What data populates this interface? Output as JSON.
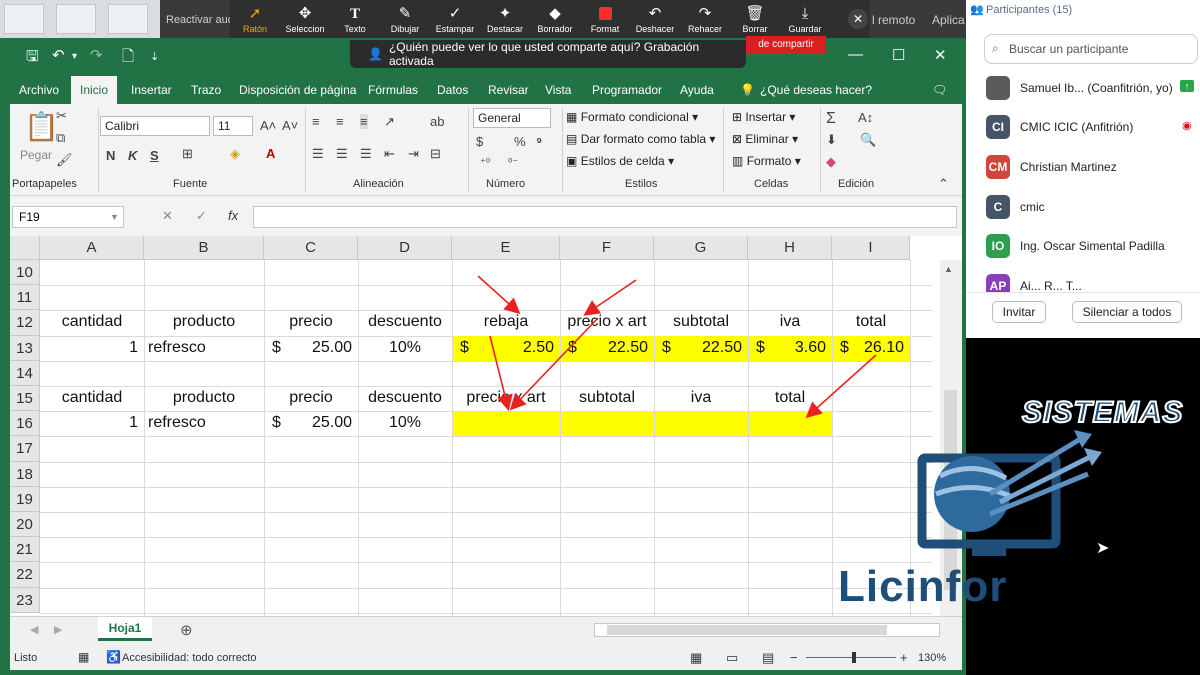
{
  "desktop": {
    "reactivar_label": "Reactivar aud"
  },
  "zoom_toolbar": {
    "tools": [
      "Ratón",
      "Seleccion",
      "Texto",
      "Dibujar",
      "Estampar",
      "Destacar",
      "Borrador",
      "Format",
      "Deshacer",
      "Rehacer",
      "Borrar",
      "Guardar"
    ],
    "active_tool": "Ratón"
  },
  "right_labels": {
    "remoto": "l remoto",
    "aplica": "Aplica"
  },
  "share_banner": {
    "text": "¿Quién puede ver lo que usted comparte aquí? Grabación activada",
    "red_label": "de compartir"
  },
  "excel": {
    "menu_tabs": [
      "Archivo",
      "Inicio",
      "Insertar",
      "Trazo",
      "Disposición de página",
      "Fórmulas",
      "Datos",
      "Revisar",
      "Vista",
      "Programador",
      "Ayuda"
    ],
    "active_tab": "Inicio",
    "tell_me": "¿Qué deseas hacer?",
    "ribbon": {
      "pegar": "Pegar",
      "font_name": "Calibri",
      "font_size": "11",
      "number_format": "General",
      "estilos_items": [
        "Formato condicional",
        "Dar formato como tabla",
        "Estilos de celda"
      ],
      "celdas_items": [
        "Insertar",
        "Eliminar",
        "Formato"
      ],
      "groups": [
        "Portapapeles",
        "Fuente",
        "Alineación",
        "Número",
        "Estilos",
        "Celdas",
        "Edición"
      ]
    },
    "name_box": "F19",
    "columns": [
      "A",
      "B",
      "C",
      "D",
      "E",
      "F",
      "G",
      "H",
      "I"
    ],
    "rows": [
      "10",
      "11",
      "12",
      "13",
      "14",
      "15",
      "16",
      "17",
      "18",
      "19",
      "20",
      "21",
      "22",
      "23"
    ],
    "row12": {
      "a": "cantidad",
      "b": "producto",
      "c": "precio",
      "d": "descuento",
      "e": "rebaja",
      "f": "precio x art",
      "g": "subtotal",
      "h": "iva",
      "i": "total"
    },
    "row13": {
      "a": "1",
      "b": "refresco",
      "c_cur": "$",
      "c": "25.00",
      "d": "10%",
      "e_cur": "$",
      "e": "2.50",
      "f_cur": "$",
      "f": "22.50",
      "g_cur": "$",
      "g": "22.50",
      "h_cur": "$",
      "h": "3.60",
      "i_cur": "$",
      "i": "26.10"
    },
    "row15": {
      "a": "cantidad",
      "b": "producto",
      "c": "precio",
      "d": "descuento",
      "e": "precio x art",
      "f": "subtotal",
      "g": "iva",
      "h": "total"
    },
    "row16": {
      "a": "1",
      "b": "refresco",
      "c_cur": "$",
      "c": "25.00",
      "d": "10%"
    },
    "sheet_tab": "Hoja1",
    "status": {
      "mode": "Listo",
      "accessibility": "Accesibilidad: todo correcto",
      "zoom": "130%"
    },
    "colors": {
      "excel_green": "#217346",
      "highlight": "#ffff00",
      "arrow": "#e8231f"
    }
  },
  "participants": {
    "header": "Participantes (15)",
    "search_placeholder": "Buscar un participante",
    "list": [
      {
        "initials": "",
        "name": "Samuel Ib... (Coanfitrión, yo)",
        "color": "#5b5b5b"
      },
      {
        "initials": "CI",
        "name": "CMIC ICIC (Anfitrión)",
        "color": "#455468"
      },
      {
        "initials": "CM",
        "name": "Christian Martinez",
        "color": "#d1453b"
      },
      {
        "initials": "C",
        "name": "cmic",
        "color": "#455468"
      },
      {
        "initials": "IO",
        "name": "Ing. Oscar Simental Padilla",
        "color": "#2e9e4f"
      },
      {
        "initials": "AP",
        "name": "Ai... R... T...",
        "color": "#8a3fb8"
      }
    ],
    "invite": "Invitar",
    "mute_all": "Silenciar a todos"
  },
  "logo": {
    "top": "SISTEMAS",
    "bottom": "Licinfor"
  }
}
